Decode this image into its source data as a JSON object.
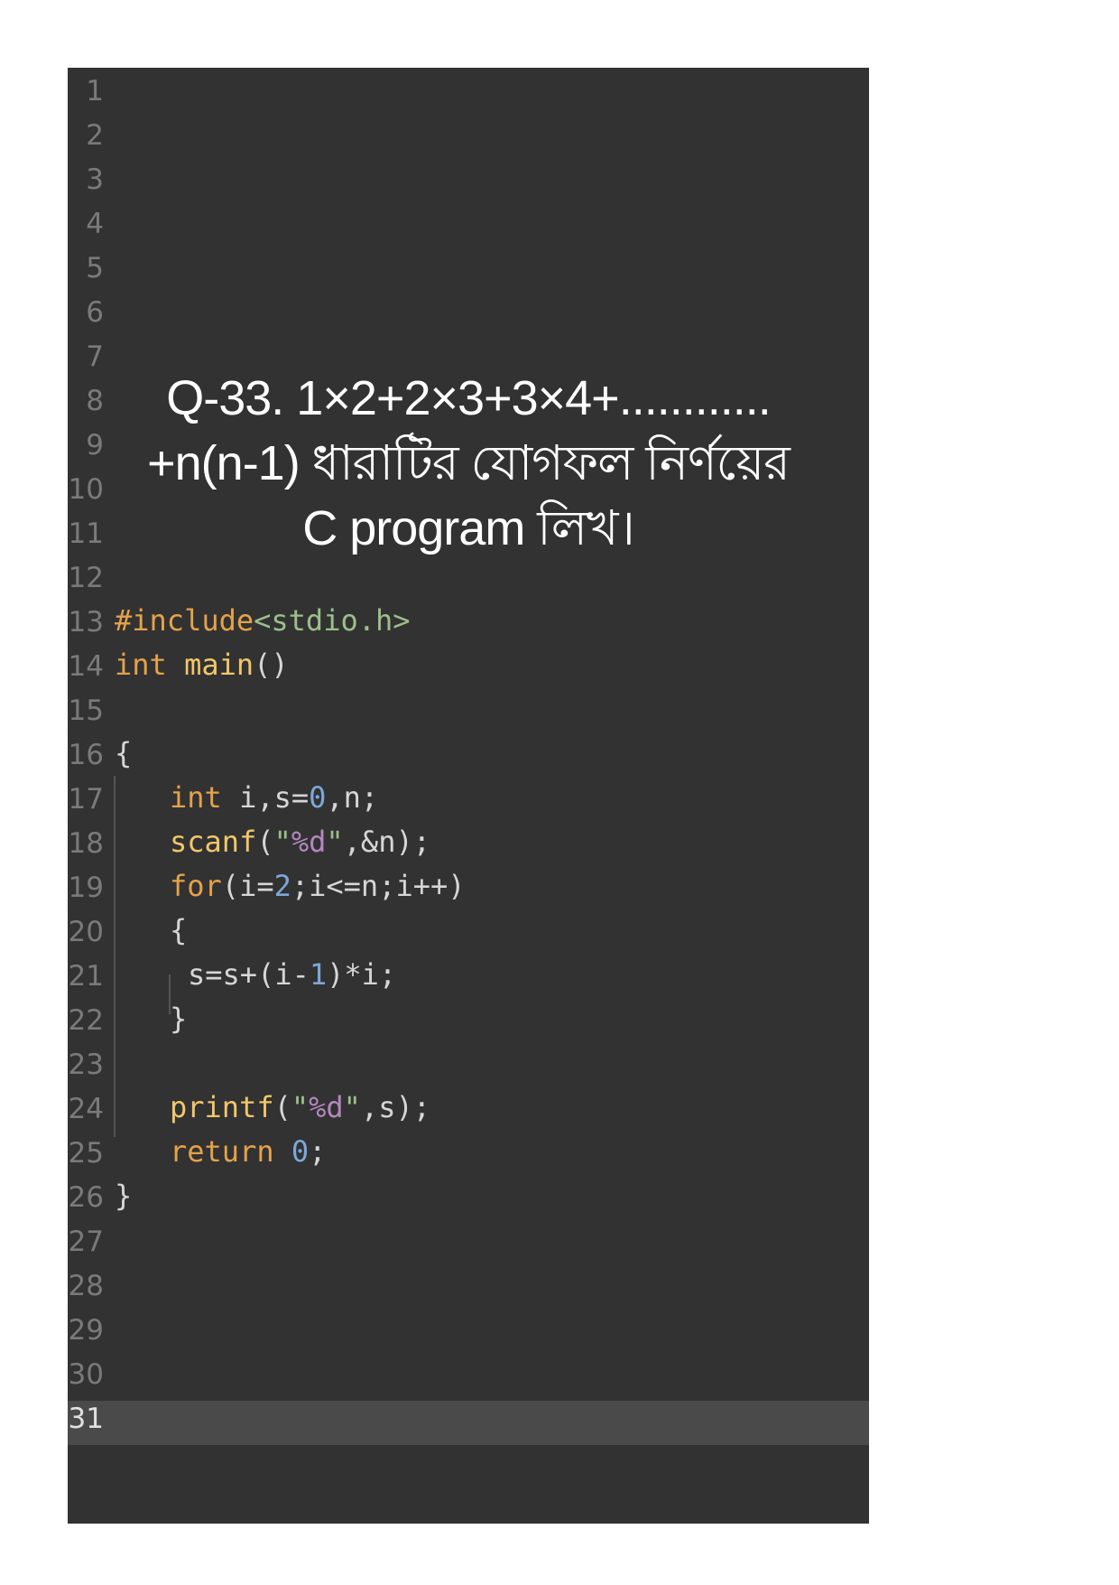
{
  "editor": {
    "current_line": 31,
    "line_numbers": [
      "1",
      "2",
      "3",
      "4",
      "5",
      "6",
      "7",
      "8",
      "9",
      "10",
      "11",
      "12",
      "13",
      "14",
      "15",
      "16",
      "17",
      "18",
      "19",
      "20",
      "21",
      "22",
      "23",
      "24",
      "25",
      "26",
      "27",
      "28",
      "29",
      "30",
      "31"
    ]
  },
  "question": {
    "line1": "Q-33. 1×2+2×3+3×4+............",
    "line2": "+n(n-1) ধারাটির যোগফল নির্ণয়ের",
    "line3": "C program লিখ।"
  },
  "code": {
    "l13": {
      "directive": "#include",
      "header": "<stdio.h>"
    },
    "l14": {
      "type": "int",
      "name": "main",
      "parens": "()"
    },
    "l16": {
      "brace": "{"
    },
    "l17": {
      "type": "int",
      "rest1": "i,s=",
      "zero": "0",
      "rest2": ",n;"
    },
    "l18": {
      "fn": "scanf",
      "open": "(",
      "q1": "\"",
      "fmt": "%d",
      "q2": "\"",
      "rest": ",&n);"
    },
    "l19": {
      "kw": "for",
      "a": "(i=",
      "two": "2",
      "b": ";i<=n;i++)"
    },
    "l20": {
      "brace": "{"
    },
    "l21": {
      "a": "s=s+(i-",
      "one": "1",
      "b": ")*i;"
    },
    "l22": {
      "brace": "}"
    },
    "l24": {
      "fn": "printf",
      "open": "(",
      "q1": "\"",
      "fmt": "%d",
      "q2": "\"",
      "rest": ",s);"
    },
    "l25": {
      "kw": "return",
      "zero": "0",
      "semi": ";"
    },
    "l26": {
      "brace": "}"
    }
  }
}
